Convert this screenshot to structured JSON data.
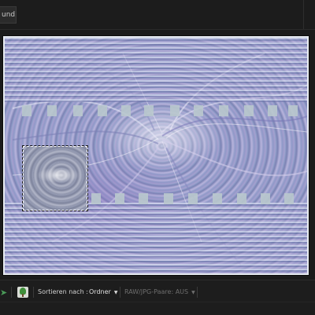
{
  "top_tab": {
    "label": "und)"
  },
  "toolbar": {
    "sort_label": "Sortieren nach :",
    "sort_value": "Ordner",
    "raw_label": "RAW/JPG-Paare: AUS"
  },
  "icons": {
    "nav": "green-arrow-icon",
    "tree": "tree-icon",
    "caret": "caret-down-icon"
  },
  "colors": {
    "app_bg": "#1b1b1b",
    "photo_border": "#e8ecf2",
    "accent_green": "#4a9a58"
  }
}
